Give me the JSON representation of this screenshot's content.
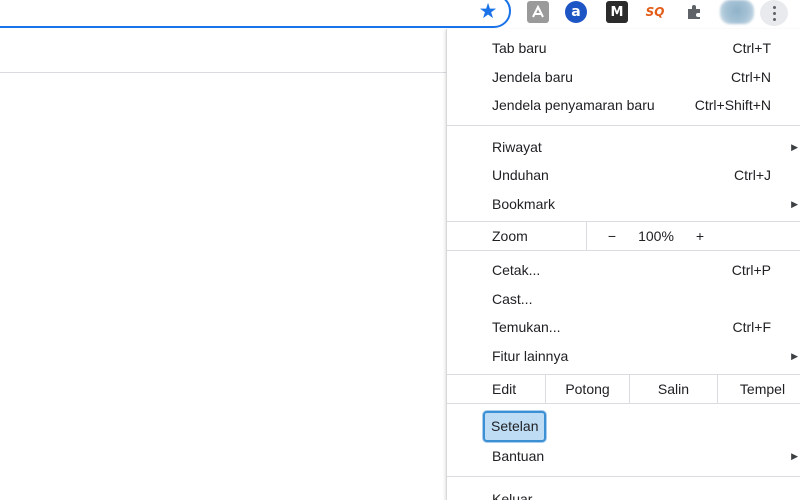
{
  "toolbar": {
    "bookmark_icon": "star-filled-icon",
    "accent_color": "#1a73e8",
    "extensions": [
      {
        "name": "pdf-icon",
        "glyph": "⬚"
      },
      {
        "name": "a-icon",
        "glyph": "a"
      },
      {
        "name": "m-icon",
        "glyph": "M"
      },
      {
        "name": "sq-icon",
        "glyph": "SQ"
      },
      {
        "name": "puzzle-icon",
        "glyph": "✚"
      }
    ]
  },
  "menu": {
    "group1": [
      {
        "label": "Tab baru",
        "shortcut": "Ctrl+T"
      },
      {
        "label": "Jendela baru",
        "shortcut": "Ctrl+N"
      },
      {
        "label": "Jendela penyamaran baru",
        "shortcut": "Ctrl+Shift+N"
      }
    ],
    "group2": [
      {
        "label": "Riwayat",
        "arrow": "▶"
      },
      {
        "label": "Unduhan",
        "shortcut": "Ctrl+J"
      },
      {
        "label": "Bookmark",
        "arrow": "▶"
      }
    ],
    "zoom": {
      "label": "Zoom",
      "minus": "−",
      "value": "100%",
      "plus": "+"
    },
    "group3": [
      {
        "label": "Cetak...",
        "shortcut": "Ctrl+P"
      },
      {
        "label": "Cast..."
      },
      {
        "label": "Temukan...",
        "shortcut": "Ctrl+F"
      },
      {
        "label": "Fitur lainnya",
        "arrow": "▶"
      }
    ],
    "edit": {
      "label": "Edit",
      "cut": "Potong",
      "copy": "Salin",
      "paste": "Tempel"
    },
    "settings": {
      "label": "Setelan",
      "highlight_color": "#3b8fd3"
    },
    "help": {
      "label": "Bantuan",
      "arrow": "▶"
    },
    "cutoff_label": "Keluar"
  }
}
